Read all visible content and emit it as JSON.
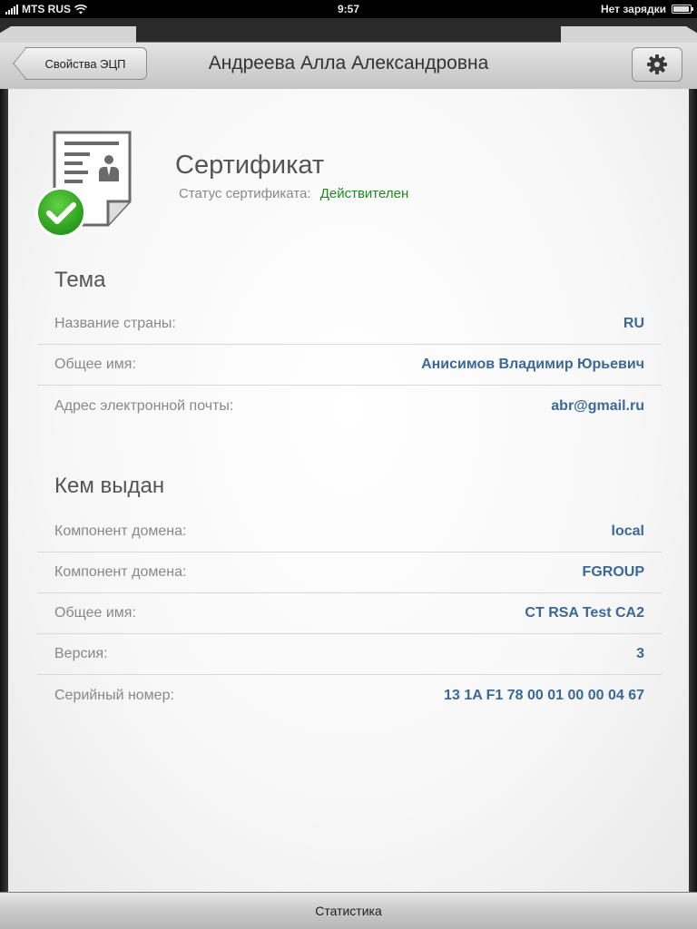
{
  "status_bar": {
    "carrier": "MTS RUS",
    "time": "9:57",
    "battery_text": "Нет зарядки"
  },
  "navbar": {
    "back_label": "Свойства ЭЦП",
    "title": "Андреева Алла Александровна",
    "settings_icon": "gear-icon"
  },
  "certificate": {
    "icon": "certificate-icon",
    "badge_icon": "checkmark-icon",
    "title": "Сертификат",
    "status_label": "Статус сертификата:",
    "status_value": "Действителен",
    "status_color": "#1e8a1e"
  },
  "subject": {
    "title": "Тема",
    "rows": [
      {
        "label": "Название страны:",
        "value": "RU"
      },
      {
        "label": "Общее имя:",
        "value": "Анисимов Владимир Юрьевич"
      },
      {
        "label": "Адрес электронной почты:",
        "value": "abr@gmail.ru"
      }
    ]
  },
  "issuer": {
    "title": "Кем выдан",
    "rows": [
      {
        "label": "Компонент домена:",
        "value": "local"
      },
      {
        "label": "Компонент домена:",
        "value": "FGROUP"
      },
      {
        "label": "Общее имя:",
        "value": "CT RSA Test CA2"
      },
      {
        "label": "Версия:",
        "value": "3"
      },
      {
        "label": "Серийный номер:",
        "value": "13 1A F1 78 00 01 00 00 04 67"
      }
    ]
  },
  "tabbar": {
    "label": "Статистика"
  },
  "colors": {
    "value_text": "#3a6898",
    "label_text": "#888888",
    "valid_green": "#1e8a1e"
  }
}
